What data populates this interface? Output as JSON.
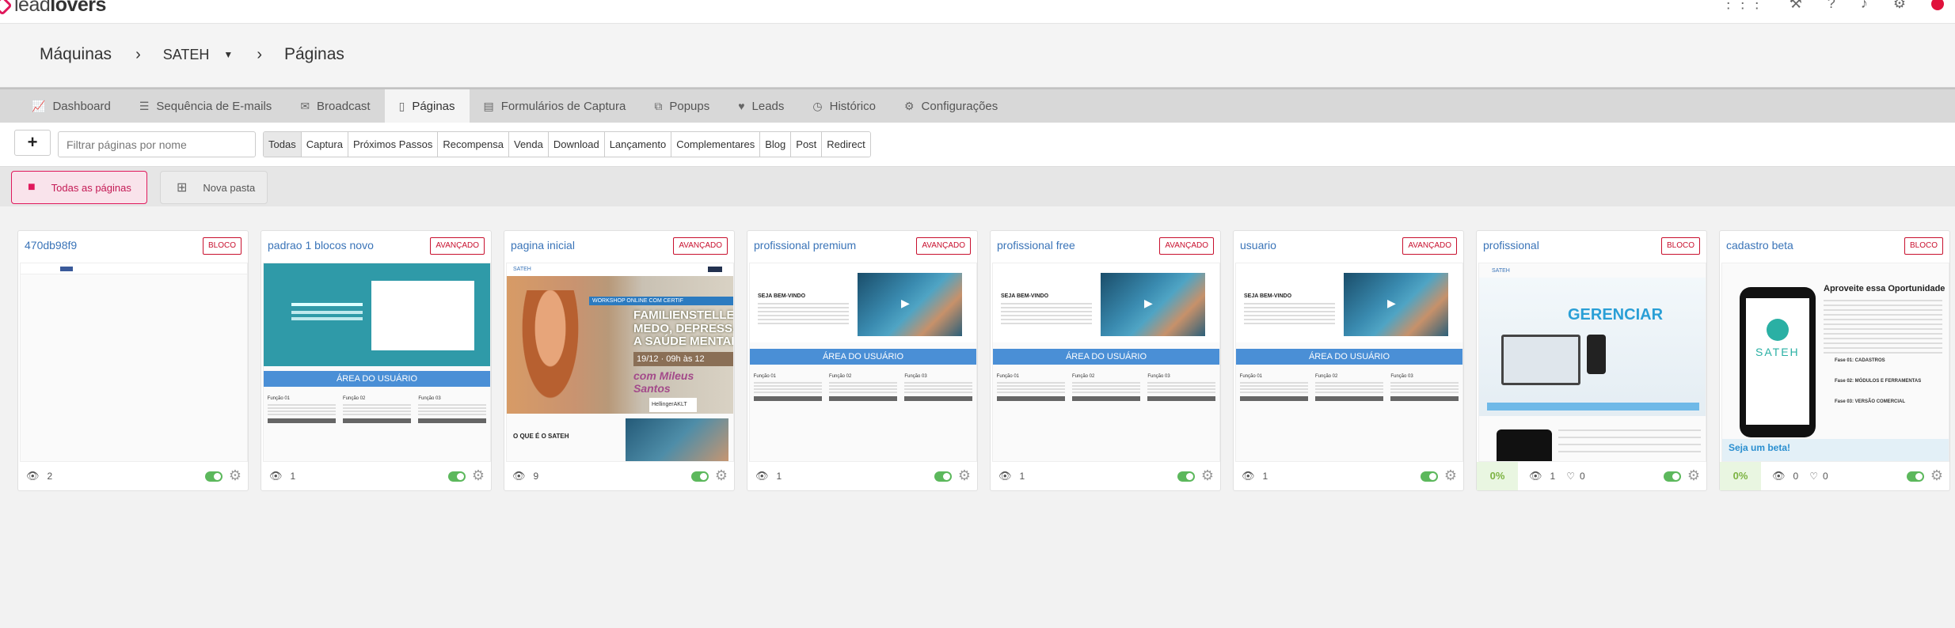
{
  "brand": {
    "lead": "lead",
    "lovers": "lovers"
  },
  "topbar_icons": [
    "apps-grid-icon",
    "tools-icon",
    "help-icon",
    "notifications-icon",
    "settings-icon",
    "avatar"
  ],
  "breadcrumb": {
    "root": "Máquinas",
    "machine": "SATEH",
    "current": "Páginas"
  },
  "tabs": [
    {
      "label": "Dashboard",
      "icon": "chart-icon"
    },
    {
      "label": "Sequência de E-mails",
      "icon": "list-icon"
    },
    {
      "label": "Broadcast",
      "icon": "mail-icon"
    },
    {
      "label": "Páginas",
      "icon": "file-icon",
      "active": true
    },
    {
      "label": "Formulários de Captura",
      "icon": "form-icon"
    },
    {
      "label": "Popups",
      "icon": "popup-icon"
    },
    {
      "label": "Leads",
      "icon": "heart-icon"
    },
    {
      "label": "Histórico",
      "icon": "clock-icon"
    },
    {
      "label": "Configurações",
      "icon": "gears-icon"
    }
  ],
  "filter": {
    "add_label": "+",
    "search_placeholder": "Filtrar páginas por nome",
    "types": [
      "Todas",
      "Captura",
      "Próximos Passos",
      "Recompensa",
      "Venda",
      "Download",
      "Lançamento",
      "Complementares",
      "Blog",
      "Post",
      "Redirect"
    ],
    "active_type": "Todas"
  },
  "folders": {
    "all_label": "Todas as páginas",
    "new_label": "Nova pasta"
  },
  "pages": [
    {
      "title": "470db98f9",
      "badge": "BLOCO",
      "views": "2",
      "thumb": "blank"
    },
    {
      "title": "padrao 1 blocos novo",
      "badge": "AVANÇADO",
      "views": "1",
      "thumb": "teal",
      "band": "ÁREA DO USUÁRIO",
      "fn": [
        "Função 01",
        "Função 02",
        "Função 03"
      ]
    },
    {
      "title": "pagina inicial",
      "badge": "AVANÇADO",
      "views": "9",
      "thumb": "photo",
      "thumb_text": {
        "brand": "SATEH",
        "workshop": "WORKSHOP ONLINE COM CERTIF",
        "headline": "FAMILIENSTELLEN\nMEDO, DEPRESSÃO E AN\nA SAÚDE MENTAL",
        "date": "19/12 · 09h às 12",
        "sign": "com Mileus Santos",
        "partner": "HellingerAKLT",
        "about": "O QUE É O SATEH"
      }
    },
    {
      "title": "profissional premium",
      "badge": "AVANÇADO",
      "views": "1",
      "thumb": "blue",
      "sb": "SEJA BEM-VINDO",
      "band": "ÁREA DO USUÁRIO",
      "fn": [
        "Função 01",
        "Função 02",
        "Função 03"
      ]
    },
    {
      "title": "profissional free",
      "badge": "AVANÇADO",
      "views": "1",
      "thumb": "blue",
      "sb": "SEJA BEM-VINDO",
      "band": "ÁREA DO USUÁRIO",
      "fn": [
        "Função 01",
        "Função 02",
        "Função 03"
      ]
    },
    {
      "title": "usuario",
      "badge": "AVANÇADO",
      "views": "1",
      "thumb": "blue",
      "sb": "SEJA BEM-VINDO",
      "band": "ÁREA DO USUÁRIO",
      "fn": [
        "Função 01",
        "Função 02",
        "Função 03"
      ]
    },
    {
      "title": "profissional",
      "badge": "BLOCO",
      "views": "1",
      "likes": "0",
      "conversion": "0%",
      "thumb": "cel",
      "thumb_text": {
        "brand": "SATEH",
        "g": "GERENCIAR"
      }
    },
    {
      "title": "cadastro beta",
      "badge": "BLOCO",
      "views": "0",
      "likes": "0",
      "conversion": "0%",
      "thumb": "beta",
      "thumb_text": {
        "brand": "SATEH",
        "title": "Aproveite essa Oportunidade",
        "f1": "Fase 01: CADASTROS",
        "f2": "Fase 02: MÓDULOS E FERRAMENTAS",
        "f3": "Fase 03: VERSÃO COMERCIAL",
        "seja": "Seja um beta!"
      }
    }
  ],
  "colors": {
    "accent": "#e0195c",
    "link": "#3a74b8",
    "badge": "#c8102e",
    "toggle_on": "#5cb85c",
    "conversion": "#7cb342"
  }
}
